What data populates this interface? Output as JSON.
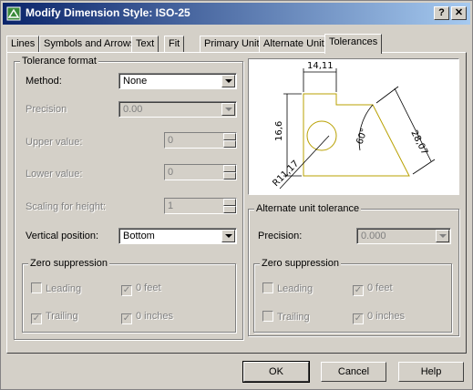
{
  "window": {
    "title": "Modify Dimension Style: ISO-25",
    "help_btn": "?",
    "close_btn": "✕"
  },
  "tabs": [
    "Lines",
    "Symbols and Arrows",
    "Text",
    "Fit",
    "Primary Units",
    "Alternate Units",
    "Tolerances"
  ],
  "tolerance_format": {
    "label": "Tolerance format",
    "method_label": "Method:",
    "method_value": "None",
    "precision_label": "Precision",
    "precision_value": "0.00",
    "upper_label": "Upper value:",
    "upper_value": "0",
    "lower_label": "Lower value:",
    "lower_value": "0",
    "scaling_label": "Scaling for height:",
    "scaling_value": "1",
    "vertical_label": "Vertical position:",
    "vertical_value": "Bottom"
  },
  "zero_left": {
    "label": "Zero suppression",
    "leading": "Leading",
    "trailing": "Trailing",
    "feet": "0 feet",
    "inches": "0 inches"
  },
  "preview": {
    "dim_top": "14,11",
    "dim_left": "16,6",
    "dim_right": "28,07",
    "angle": "60°",
    "radius": "R11,17"
  },
  "alt_tol": {
    "label": "Alternate unit tolerance",
    "precision_label": "Precision:",
    "precision_value": "0.000"
  },
  "zero_right": {
    "label": "Zero suppression",
    "leading": "Leading",
    "trailing": "Trailing",
    "feet": "0 feet",
    "inches": "0 inches"
  },
  "buttons": {
    "ok": "OK",
    "cancel": "Cancel",
    "help": "Help"
  },
  "colors": {
    "title_start": "#0a246a",
    "title_end": "#a6caf0",
    "face": "#d4d0c8",
    "drawing": "#b8a000"
  }
}
